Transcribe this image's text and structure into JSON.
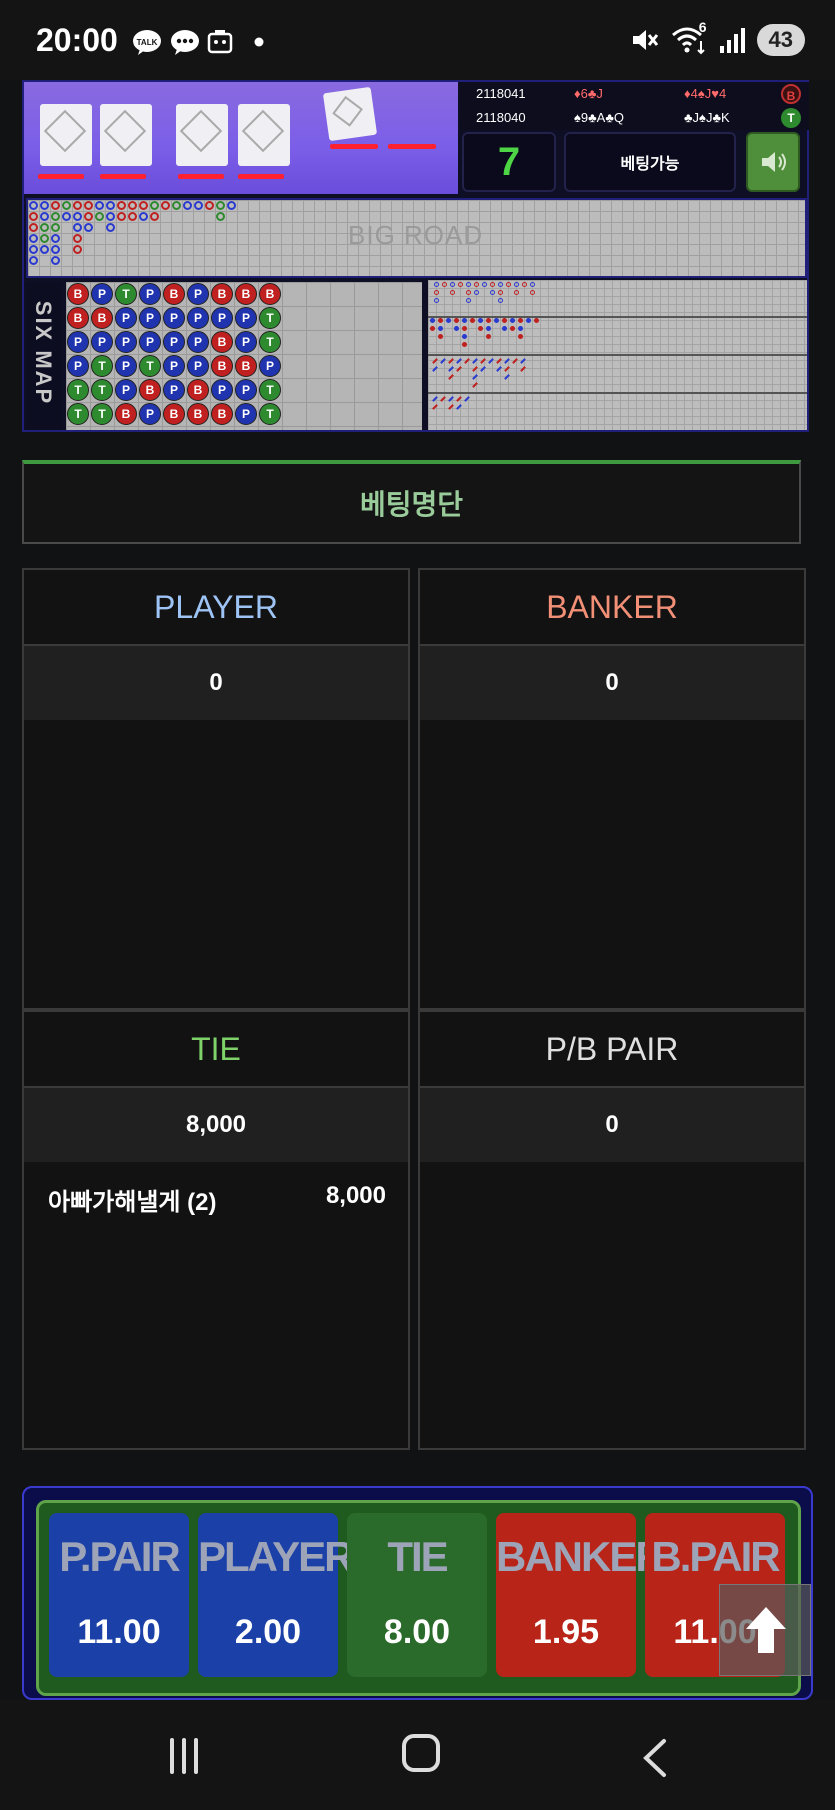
{
  "status_bar": {
    "time": "20:00",
    "notif_talk": "TALK",
    "wifi_badge": "6",
    "battery": "43"
  },
  "game": {
    "history": [
      {
        "round": "2118041",
        "player_cards": "♦6♣J",
        "banker_cards": "♦4♠J♥4",
        "result": "B"
      },
      {
        "round": "2118040",
        "player_cards": "♠9♣A♣Q",
        "banker_cards": "♣J♠J♣K",
        "result": "T"
      }
    ],
    "countdown": "7",
    "bet_status": "베팅가능",
    "big_road_label": "BIG ROAD",
    "six_map_label": "SIX MAP",
    "six_map_columns": [
      [
        "B",
        "B",
        "P",
        "P",
        "T",
        "T"
      ],
      [
        "P",
        "B",
        "P",
        "T",
        "T",
        "T"
      ],
      [
        "T",
        "P",
        "P",
        "P",
        "P",
        "B"
      ],
      [
        "P",
        "P",
        "P",
        "T",
        "B",
        "P"
      ],
      [
        "B",
        "P",
        "P",
        "P",
        "P",
        "B"
      ],
      [
        "P",
        "P",
        "P",
        "P",
        "B",
        "B"
      ],
      [
        "B",
        "P",
        "B",
        "B",
        "P",
        "B"
      ],
      [
        "B",
        "P",
        "P",
        "B",
        "P",
        "P"
      ],
      [
        "B",
        "T",
        "T",
        "P",
        "T",
        "T"
      ]
    ]
  },
  "bet_list": {
    "title": "베팅명단",
    "panels": [
      {
        "label": "PLAYER",
        "total": "0",
        "entries": []
      },
      {
        "label": "BANKER",
        "total": "0",
        "entries": []
      },
      {
        "label": "TIE",
        "total": "8,000",
        "entries": [
          {
            "name": "아빠가해낼게 (2)",
            "amount": "8,000"
          }
        ]
      },
      {
        "label": "P/B PAIR",
        "total": "0",
        "entries": []
      }
    ]
  },
  "bet_buttons": [
    {
      "label": "P.PAIR",
      "odds": "11.00"
    },
    {
      "label": "PLAYER",
      "odds": "2.00"
    },
    {
      "label": "TIE",
      "odds": "8.00"
    },
    {
      "label": "BANKER",
      "odds": "1.95"
    },
    {
      "label": "B.PAIR",
      "odds": "11.00"
    }
  ],
  "colors": {
    "player": "#9ec3f5",
    "banker": "#f29077",
    "tie": "#7fd16a",
    "pair": "#e0e0e0",
    "countdown": "#4ed545"
  }
}
